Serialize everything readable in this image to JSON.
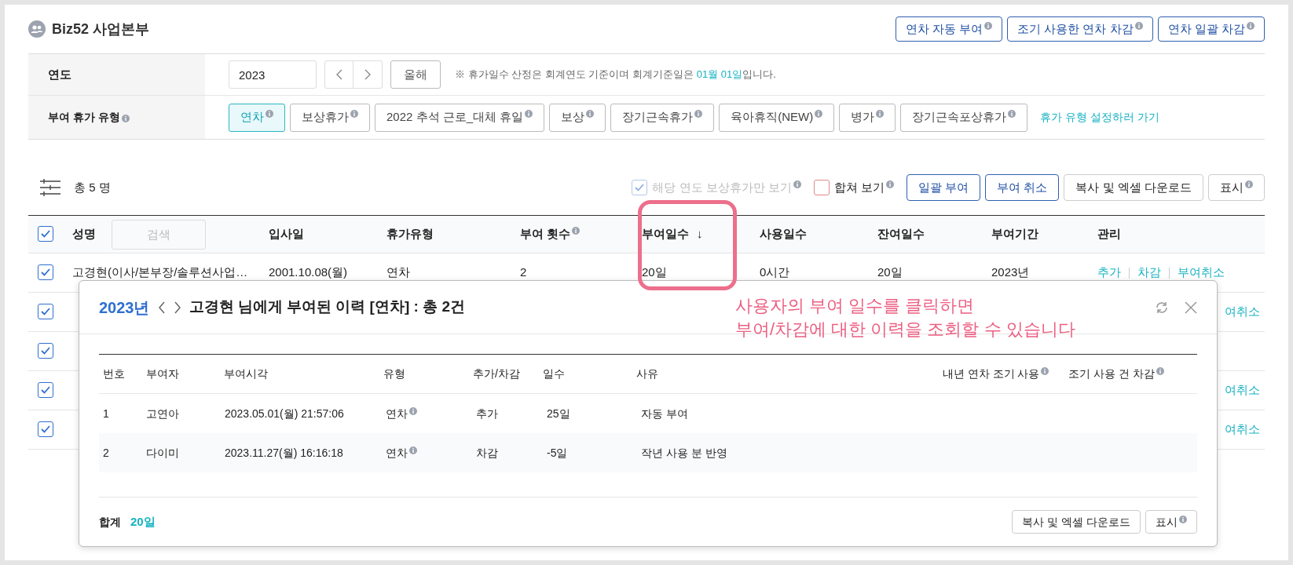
{
  "header": {
    "title": "Biz52 사업본부",
    "buttons": [
      {
        "label": "연차 자동 부여",
        "info": true
      },
      {
        "label": "조기 사용한 연차 차감",
        "info": true
      },
      {
        "label": "연차 일괄 차감",
        "info": true
      }
    ]
  },
  "filters": {
    "year_label": "연도",
    "year_value": "2023",
    "this_year_button": "올해",
    "note_prefix": "※  휴가일수 산정은 회계연도 기준이며 회계기준일은 ",
    "note_highlight": "01월 01일",
    "note_suffix": "입니다.",
    "type_label": "부여 휴가 유형",
    "types": [
      {
        "label": "연차",
        "selected": true
      },
      {
        "label": "보상휴가",
        "selected": false
      },
      {
        "label": "2022 추석 근로_대체 휴일",
        "selected": false
      },
      {
        "label": "보상",
        "selected": false
      },
      {
        "label": "장기근속휴가",
        "selected": false
      },
      {
        "label": "육아휴직(NEW)",
        "selected": false
      },
      {
        "label": "병가",
        "selected": false
      },
      {
        "label": "장기근속포상휴가",
        "selected": false
      }
    ],
    "settings_link": "휴가 유형 설정하러 가기"
  },
  "toolbar": {
    "count": "총 5 명",
    "comp_only": {
      "label": "해당 연도 보상휴가만 보기",
      "checked": true,
      "disabled": true
    },
    "merge": {
      "label": "합쳐 보기",
      "checked": false
    },
    "buttons": [
      {
        "label": "일괄 부여",
        "kind": "outline"
      },
      {
        "label": "부여 취소",
        "kind": "outline"
      },
      {
        "label": "복사 및 엑셀 다운로드",
        "kind": "plain"
      },
      {
        "label": "표시",
        "kind": "plain",
        "info": true
      }
    ]
  },
  "table": {
    "all_checked": true,
    "search_placeholder": "검색",
    "columns": [
      {
        "label": "성명"
      },
      {
        "label": "입사일"
      },
      {
        "label": "휴가유형"
      },
      {
        "label": "부여 횟수",
        "info": true
      },
      {
        "label": "부여일수",
        "sort": "↓"
      },
      {
        "label": "사용일수"
      },
      {
        "label": "잔여일수"
      },
      {
        "label": "부여기간"
      },
      {
        "label": "관리"
      }
    ],
    "rows": [
      {
        "checked": true,
        "cells": [
          "고경현(이사/본부장/솔루션사업…",
          "2001.10.08(월)",
          "연차",
          "2",
          "20일",
          "0시간",
          "20일",
          "2023년"
        ],
        "actions": [
          "추가",
          "차감",
          "부여취소"
        ]
      },
      {
        "checked": true,
        "actions": [
          "여취소"
        ]
      },
      {
        "checked": true,
        "actions": []
      },
      {
        "checked": true,
        "actions": [
          "여취소"
        ]
      },
      {
        "checked": true,
        "actions": [
          "여취소"
        ]
      }
    ]
  },
  "modal": {
    "year": "2023년",
    "title": "고경현 님에게 부여된 이력 [연차] : 총 2건",
    "columns": [
      {
        "label": "번호"
      },
      {
        "label": "부여자"
      },
      {
        "label": "부여시각"
      },
      {
        "label": "유형"
      },
      {
        "label": "추가/차감"
      },
      {
        "label": "일수"
      },
      {
        "label": "사유"
      },
      {
        "label": "내년 연차 조기 사용",
        "info": true
      },
      {
        "label": "조기 사용 건 차감",
        "info": true
      }
    ],
    "rows": [
      [
        "1",
        "고연아",
        "2023.05.01(월) 21:57:06",
        "연차",
        "추가",
        "25일",
        "자동 부여"
      ],
      [
        "2",
        "다이미",
        "2023.11.27(월) 16:16:18",
        "연차",
        "차감",
        "-5일",
        "작년 사용 분 반영"
      ]
    ],
    "total_label": "합계",
    "total_value": "20일",
    "buttons": [
      {
        "label": "복사 및 엑셀 다운로드",
        "info": false
      },
      {
        "label": "표시",
        "info": true
      }
    ]
  },
  "annotation": {
    "lines": [
      "사용자의 부여 일수를 클릭하면",
      "부여/차감에 대한 이력을 조회할 수 있습니다"
    ]
  }
}
